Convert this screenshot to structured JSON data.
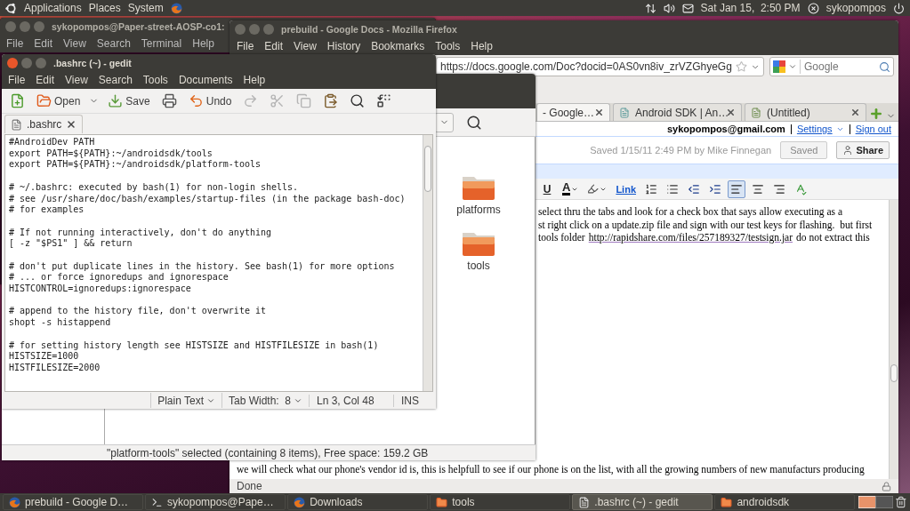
{
  "top_panel": {
    "menus": [
      "Applications",
      "Places",
      "System"
    ],
    "clock": "Sat Jan 15,  2:50 PM",
    "user": "sykopompos"
  },
  "terminal": {
    "title": "sykopompos@Paper-street-AOSP-co1:",
    "menu": [
      "File",
      "Edit",
      "View",
      "Search",
      "Terminal",
      "Help"
    ]
  },
  "firefox": {
    "title": "prebuild - Google Docs - Mozilla Firefox",
    "menu": [
      "File",
      "Edit",
      "View",
      "History",
      "Bookmarks",
      "Tools",
      "Help"
    ],
    "url": "https://docs.google.com/Doc?docid=0AS0vn8iv_zrVZGhyeGg",
    "search": {
      "placeholder": "Google"
    },
    "tabs": [
      {
        "label": "- Google…",
        "selected": true
      },
      {
        "label": "Android SDK | An…",
        "selected": false
      },
      {
        "label": "(Untitled)",
        "selected": false
      }
    ],
    "account": {
      "email": "sykopompos@gmail.com",
      "settings": "Settings",
      "sign_out": "Sign out"
    },
    "saved_info": "Saved 1/15/11 2:49 PM by Mike Finnegan",
    "saved_button": "Saved",
    "share_button": "Share",
    "format_toolbar": [
      {
        "kind": "underline",
        "label": "U"
      },
      {
        "kind": "textcolor",
        "label": "A"
      },
      {
        "kind": "highlight"
      },
      {
        "kind": "link",
        "label": "Link"
      },
      {
        "kind": "numbered"
      },
      {
        "kind": "bullets"
      },
      {
        "kind": "outdent"
      },
      {
        "kind": "indent"
      },
      {
        "kind": "alignleft",
        "selected": true
      },
      {
        "kind": "aligncenter",
        "selected": false
      },
      {
        "kind": "alignright",
        "selected": false
      },
      {
        "kind": "spellcheck"
      }
    ],
    "document_lines": [
      {
        "text": "select thru the tabs and look for a check box that says allow executing as a"
      },
      {
        "text": "st right click on a update.zip file and sign with our test keys for flashing.  but first"
      },
      {
        "text": "tools folder",
        "link": "http://rapidshare.com/files/257189327/testsign.jar",
        "after": "do not extract this"
      }
    ],
    "bottom_line": "we will check what our phone's vendor id is, this is helpfull to see if our phone is on the list, with all the growing numbers of new manufacturs producing",
    "status": "Done"
  },
  "nautilus": {
    "folders": [
      "platforms",
      "tools"
    ],
    "status": "\"platform-tools\" selected (containing 8 items), Free space: 159.2 GB"
  },
  "gedit": {
    "title": ".bashrc (~) - gedit",
    "menu": [
      "File",
      "Edit",
      "View",
      "Search",
      "Tools",
      "Documents",
      "Help"
    ],
    "toolbar": [
      {
        "kind": "new",
        "disabled": false
      },
      {
        "kind": "open",
        "label": "Open",
        "disabled": false
      },
      {
        "kind": "save",
        "label": "Save",
        "disabled": false
      },
      {
        "kind": "print",
        "disabled": false
      },
      {
        "kind": "undo",
        "label": "Undo",
        "disabled": false
      },
      {
        "kind": "redo",
        "disabled": true
      },
      {
        "kind": "cut",
        "disabled": true
      },
      {
        "kind": "copy",
        "disabled": true
      },
      {
        "kind": "paste",
        "disabled": false
      },
      {
        "kind": "find",
        "disabled": false
      },
      {
        "kind": "replace",
        "disabled": false
      }
    ],
    "tab": ".bashrc",
    "blocks": [
      [
        "#AndroidDev PATH",
        "export PATH=${PATH}:~/androidsdk/tools",
        "export PATH=${PATH}:~/androidsdk/platform-tools"
      ],
      [
        "# ~/.bashrc: executed by bash(1) for non-login shells.",
        "# see /usr/share/doc/bash/examples/startup-files (in the package bash-doc)",
        "# for examples"
      ],
      [
        "# If not running interactively, don't do anything",
        "[ -z \"$PS1\" ] && return"
      ],
      [
        "# don't put duplicate lines in the history. See bash(1) for more options",
        "# ... or force ignoredups and ignorespace",
        "HISTCONTROL=ignoredups:ignorespace"
      ],
      [
        "# append to the history file, don't overwrite it",
        "shopt -s histappend"
      ],
      [
        "# for setting history length see HISTSIZE and HISTFILESIZE in bash(1)",
        "HISTSIZE=1000",
        "HISTFILESIZE=2000"
      ]
    ],
    "status": {
      "language": "Plain Text",
      "tab_width": "Tab Width:  8",
      "position": "Ln 3, Col 48",
      "mode": "INS"
    }
  },
  "taskbar": [
    {
      "kind": "browser",
      "label": "prebuild - Google D…",
      "selected": false
    },
    {
      "kind": "terminal",
      "label": "sykopompos@Pape…",
      "selected": false
    },
    {
      "kind": "browser",
      "label": "Downloads",
      "selected": false
    },
    {
      "kind": "folder",
      "label": "tools",
      "selected": false
    },
    {
      "kind": "editor",
      "label": ".bashrc (~) - gedit",
      "selected": true
    },
    {
      "kind": "folder",
      "label": "androidsdk",
      "selected": false
    }
  ]
}
